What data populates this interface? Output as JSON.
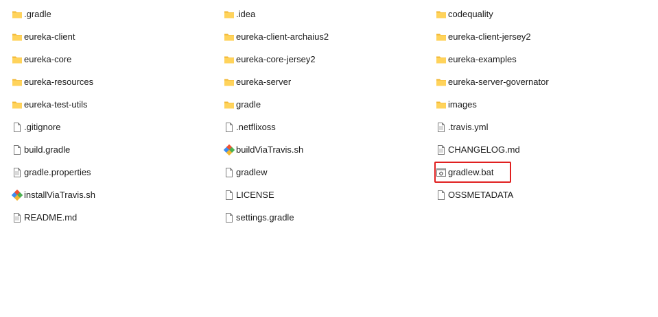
{
  "accent": {
    "folder_fill": "#FFD35B",
    "folder_back": "#F2B733",
    "highlight": "#E02020",
    "git_orange": "#F05133",
    "git_green": "#4CB050",
    "git_blue": "#3C8CF0"
  },
  "items": [
    {
      "label": ".gradle",
      "type": "folder",
      "icon": "folder-icon"
    },
    {
      "label": ".idea",
      "type": "folder",
      "icon": "folder-icon"
    },
    {
      "label": "codequality",
      "type": "folder",
      "icon": "folder-icon"
    },
    {
      "label": "eureka-client",
      "type": "folder",
      "icon": "folder-icon"
    },
    {
      "label": "eureka-client-archaius2",
      "type": "folder",
      "icon": "folder-icon"
    },
    {
      "label": "eureka-client-jersey2",
      "type": "folder",
      "icon": "folder-icon"
    },
    {
      "label": "eureka-core",
      "type": "folder",
      "icon": "folder-icon"
    },
    {
      "label": "eureka-core-jersey2",
      "type": "folder",
      "icon": "folder-icon"
    },
    {
      "label": "eureka-examples",
      "type": "folder",
      "icon": "folder-icon"
    },
    {
      "label": "eureka-resources",
      "type": "folder",
      "icon": "folder-icon"
    },
    {
      "label": "eureka-server",
      "type": "folder",
      "icon": "folder-icon"
    },
    {
      "label": "eureka-server-governator",
      "type": "folder",
      "icon": "folder-icon"
    },
    {
      "label": "eureka-test-utils",
      "type": "folder",
      "icon": "folder-icon"
    },
    {
      "label": "gradle",
      "type": "folder",
      "icon": "folder-icon"
    },
    {
      "label": "images",
      "type": "folder",
      "icon": "folder-icon"
    },
    {
      "label": ".gitignore",
      "type": "file",
      "icon": "file-icon"
    },
    {
      "label": ".netflixoss",
      "type": "file",
      "icon": "file-icon"
    },
    {
      "label": ".travis.yml",
      "type": "text",
      "icon": "text-file-icon"
    },
    {
      "label": "build.gradle",
      "type": "file",
      "icon": "file-icon"
    },
    {
      "label": "buildViaTravis.sh",
      "type": "git",
      "icon": "git-script-icon"
    },
    {
      "label": "CHANGELOG.md",
      "type": "text",
      "icon": "text-file-icon"
    },
    {
      "label": "gradle.properties",
      "type": "text",
      "icon": "text-file-icon"
    },
    {
      "label": "gradlew",
      "type": "file",
      "icon": "file-icon"
    },
    {
      "label": "gradlew.bat",
      "type": "bat",
      "icon": "batch-file-icon",
      "highlighted": true
    },
    {
      "label": "installViaTravis.sh",
      "type": "git",
      "icon": "git-script-icon"
    },
    {
      "label": "LICENSE",
      "type": "file",
      "icon": "file-icon"
    },
    {
      "label": "OSSMETADATA",
      "type": "file",
      "icon": "file-icon"
    },
    {
      "label": "README.md",
      "type": "text",
      "icon": "text-file-icon"
    },
    {
      "label": "settings.gradle",
      "type": "file",
      "icon": "file-icon"
    }
  ]
}
